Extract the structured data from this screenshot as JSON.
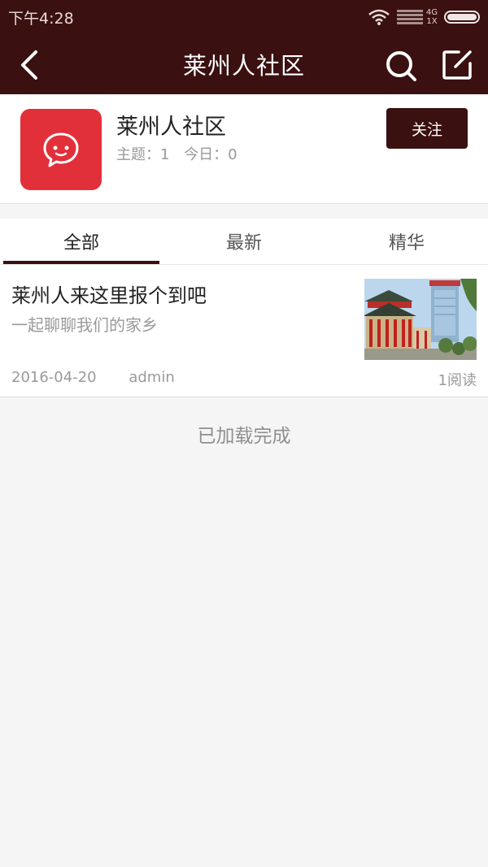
{
  "status_bar": {
    "time": "下午4:28",
    "network_top": "4G",
    "network_bottom": "1X"
  },
  "header": {
    "title": "莱州人社区"
  },
  "forum": {
    "name": "莱州人社区",
    "topics": "主题：1",
    "today": "今日：0",
    "follow_label": "关注",
    "icon": "chat-bubble-icon",
    "accent": "#e2303a"
  },
  "tabs": [
    {
      "label": "全部",
      "active": true
    },
    {
      "label": "最新",
      "active": false
    },
    {
      "label": "精华",
      "active": false
    }
  ],
  "posts": [
    {
      "title": "莱州人来这里报个到吧",
      "subtitle": "一起聊聊我们的家乡",
      "date": "2016-04-20",
      "author": "admin",
      "reads": "1阅读"
    }
  ],
  "footer": {
    "loaded_text": "已加载完成"
  },
  "colors": {
    "primary": "#3a1010",
    "background": "#f5f5f5"
  }
}
